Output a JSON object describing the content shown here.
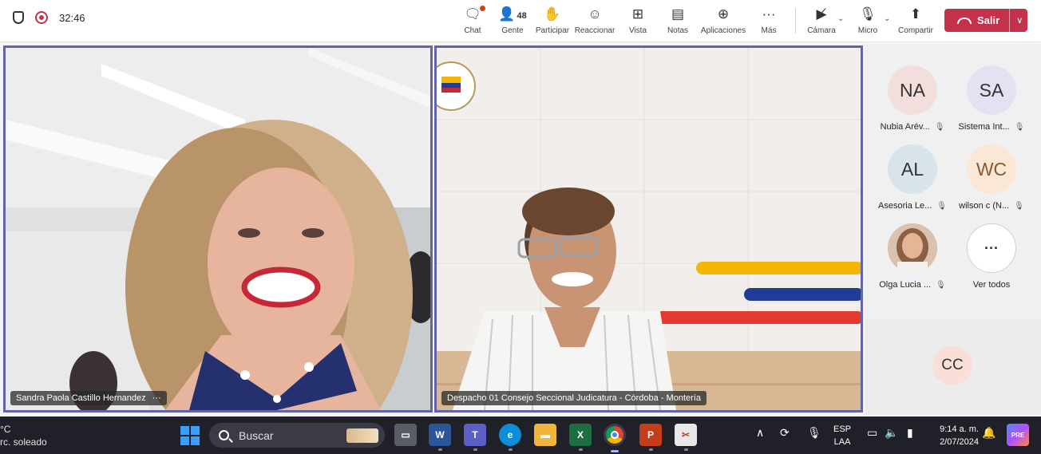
{
  "meeting": {
    "timer": "32:46",
    "toolbar": [
      {
        "id": "chat",
        "label": "Chat",
        "icon": "chat-icon"
      },
      {
        "id": "people",
        "label": "Gente",
        "icon": "people-icon",
        "count": "48"
      },
      {
        "id": "raise",
        "label": "Participar",
        "icon": "raise-hand-icon"
      },
      {
        "id": "react",
        "label": "Reaccionar",
        "icon": "smile-icon"
      },
      {
        "id": "view",
        "label": "Vista",
        "icon": "grid-icon"
      },
      {
        "id": "notes",
        "label": "Notas",
        "icon": "notes-icon"
      },
      {
        "id": "apps",
        "label": "Aplicaciones",
        "icon": "plus-icon"
      },
      {
        "id": "more",
        "label": "Más",
        "icon": "more-icon"
      },
      {
        "id": "camera",
        "label": "Cámara",
        "icon": "camera-off-icon"
      },
      {
        "id": "mic",
        "label": "Micro",
        "icon": "mic-off-icon"
      },
      {
        "id": "share",
        "label": "Compartir",
        "icon": "share-icon"
      }
    ],
    "leave_label": "Salir",
    "accent_color": "#6264a7",
    "leave_color": "#c4314b"
  },
  "videos": [
    {
      "name": "Sandra Paola Castillo Hernandez",
      "more": "···"
    },
    {
      "name": "Despacho 01 Consejo Seccional Judicatura - Córdoba - Montería"
    }
  ],
  "participants": [
    {
      "initials": "NA",
      "name": "Nubia Arév...",
      "color": "#f3dede"
    },
    {
      "initials": "SA",
      "name": "Sistema Int...",
      "color": "#e6e1f2"
    },
    {
      "initials": "AL",
      "name": "Asesoria Le...",
      "color": "#d9e4ea"
    },
    {
      "initials": "WC",
      "name": "wilson c (N...",
      "color": "#fbe7d6"
    },
    {
      "initials": "",
      "name": "Olga Lucia ...",
      "color": "#cfa98d"
    },
    {
      "initials": "···",
      "name": "Ver todos",
      "color": "#ffffff"
    }
  ],
  "cc_participant": {
    "initials": "CC",
    "color": "#fadfd9"
  },
  "taskbar": {
    "weather_temp": "°C",
    "weather_desc": "rc. soleado",
    "search_placeholder": "Buscar",
    "lang1": "ESP",
    "lang2": "LAA",
    "time": "9:14 a. m.",
    "date": "2/07/2024"
  }
}
